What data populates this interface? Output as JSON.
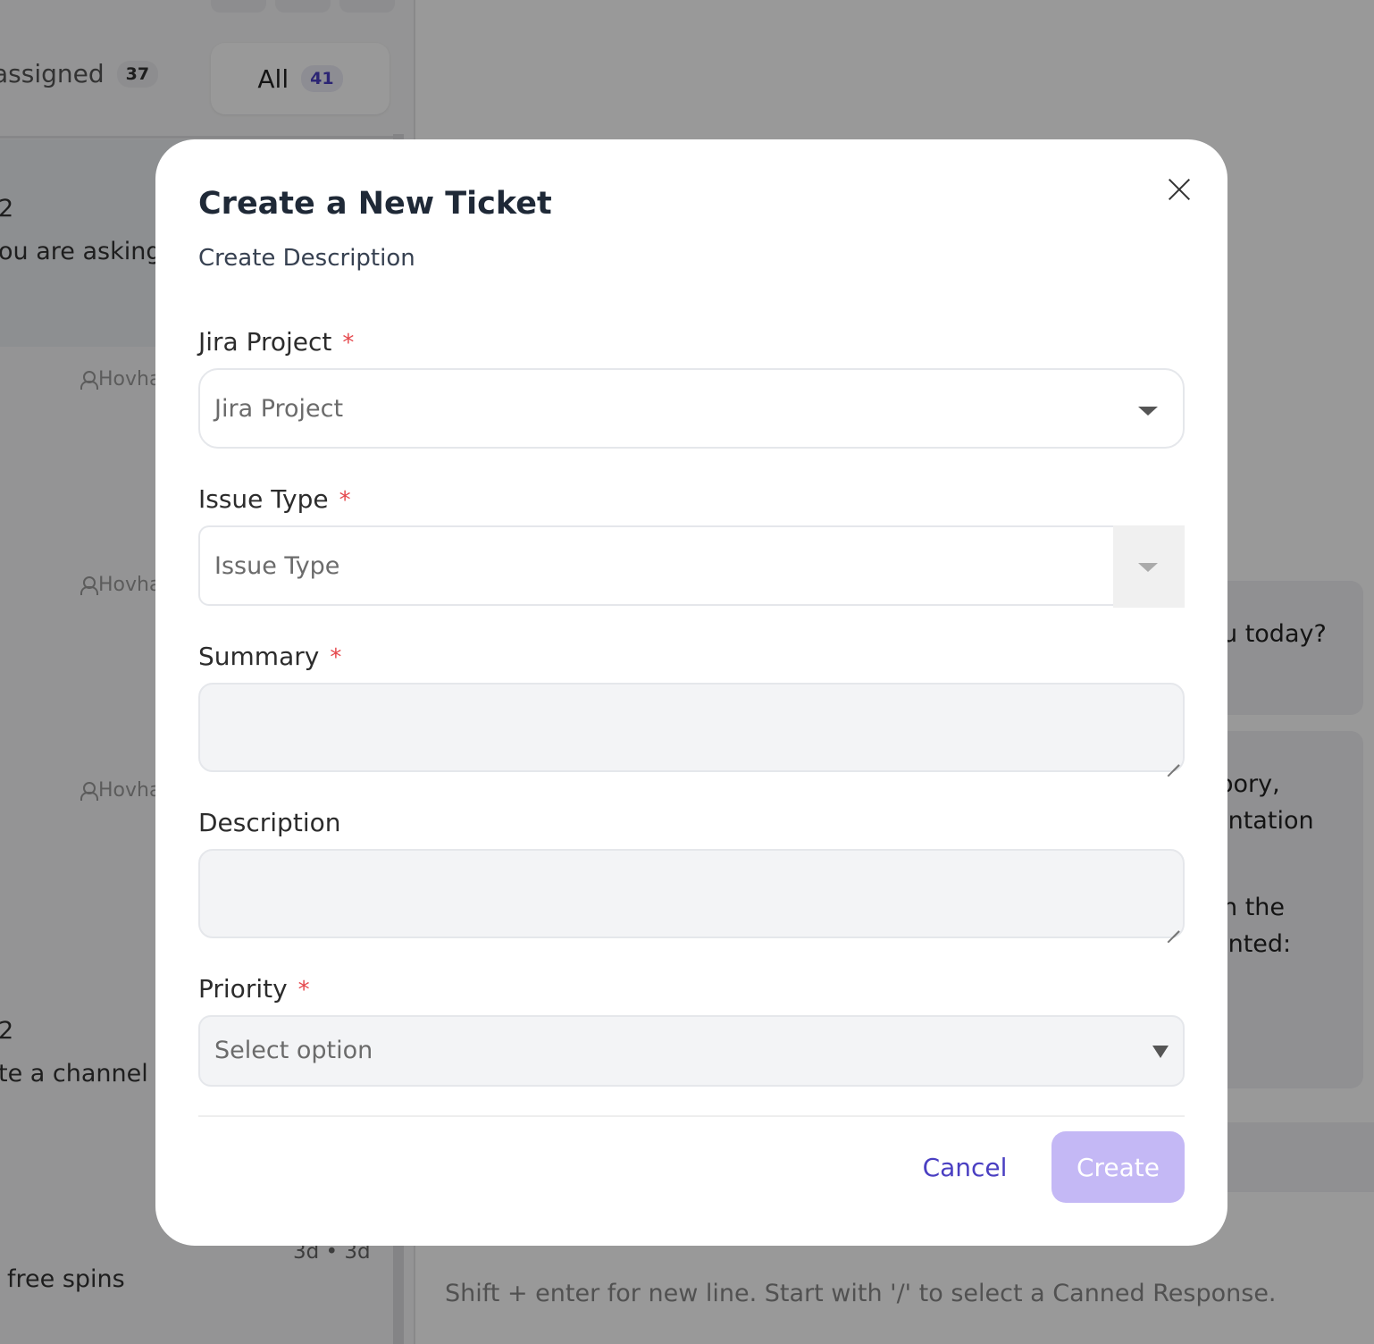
{
  "background": {
    "tabs": {
      "unassigned_label": "assigned",
      "unassigned_count": "37",
      "all_label": "All",
      "all_count": "41"
    },
    "conversations": [
      {
        "line1": "2",
        "line2": "ou are asking",
        "agent": "Hovha"
      },
      {
        "agent": "Hovha"
      },
      {
        "agent": "Hovha"
      },
      {
        "line1": "2",
        "line2": "te a channel f",
        "time": "3d • 3d",
        "line3": "free spins"
      }
    ],
    "messages": [
      {
        "lines": [
          "u today?"
        ]
      },
      {
        "lines": [
          "oory,",
          "entation",
          "n the",
          "ented:"
        ]
      }
    ],
    "composer_placeholder": "Shift + enter for new line. Start with '/' to select a Canned Response."
  },
  "modal": {
    "title": "Create a New Ticket",
    "subtitle": "Create Description",
    "close_icon": "close-icon",
    "fields": {
      "jira_project": {
        "label": "Jira Project",
        "required_mark": "*",
        "placeholder": "Jira Project"
      },
      "issue_type": {
        "label": "Issue Type",
        "required_mark": "*",
        "placeholder": "Issue Type"
      },
      "summary": {
        "label": "Summary",
        "required_mark": "*",
        "value": ""
      },
      "description": {
        "label": "Description",
        "value": ""
      },
      "priority": {
        "label": "Priority",
        "required_mark": "*",
        "placeholder": "Select option"
      }
    },
    "buttons": {
      "cancel": "Cancel",
      "create": "Create"
    },
    "colors": {
      "accent": "#4a3fc2",
      "create_disabled": "#c4b8f5",
      "required": "#e5484d"
    }
  }
}
